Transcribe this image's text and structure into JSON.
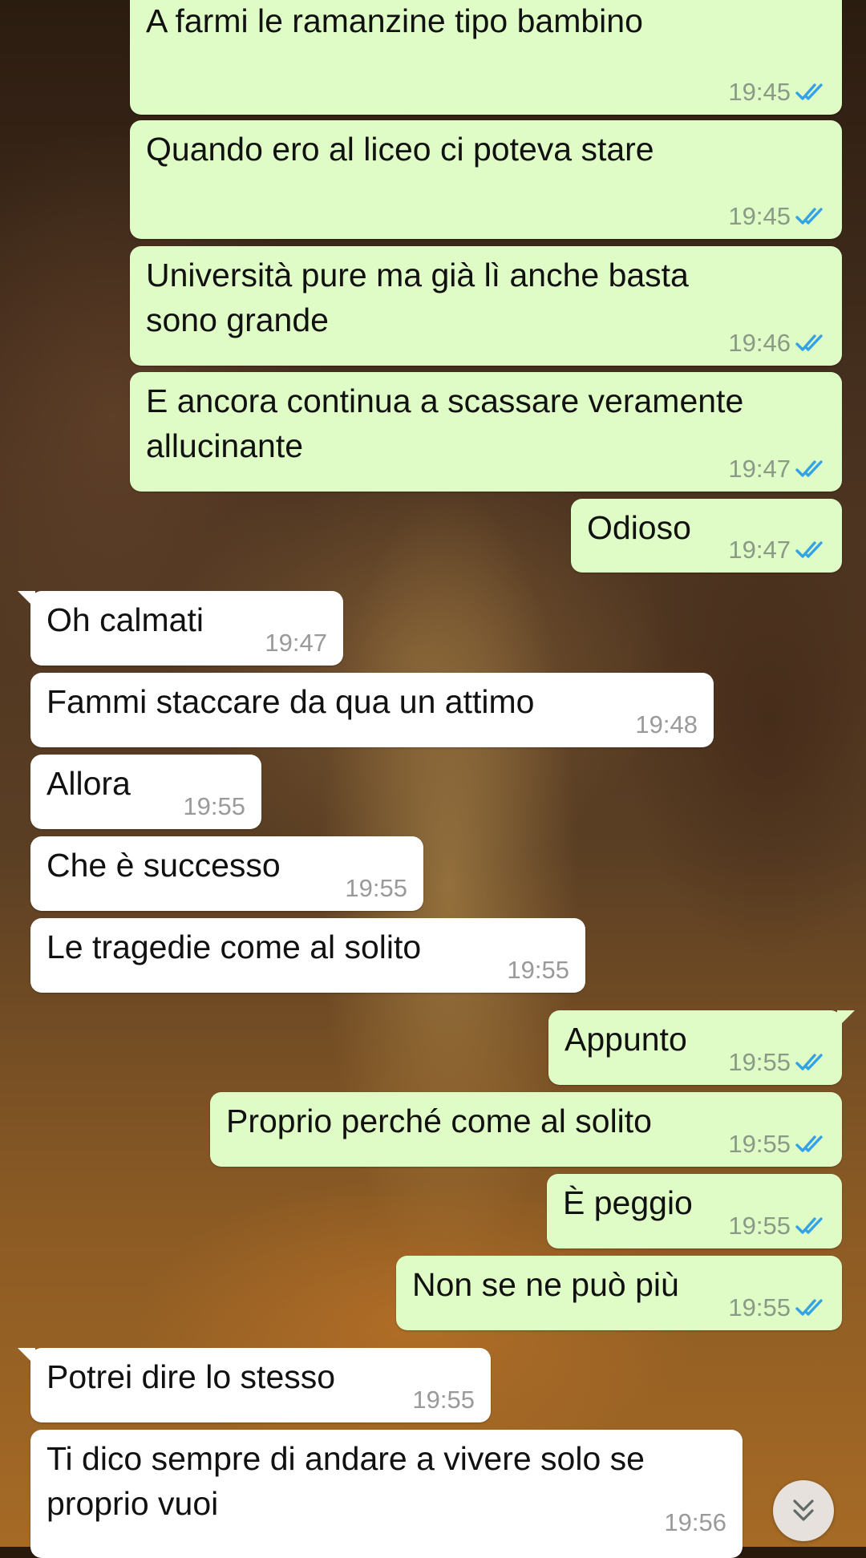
{
  "chat": {
    "messages": [
      {
        "dir": "out",
        "text": "A farmi le ramanzine tipo bambino",
        "time": "19:45",
        "read": true
      },
      {
        "dir": "out",
        "text": "Quando ero al liceo ci poteva stare",
        "time": "19:45",
        "read": true
      },
      {
        "dir": "out",
        "text": "Università pure ma già lì anche basta\nsono grande",
        "time": "19:46",
        "read": true
      },
      {
        "dir": "out",
        "text": "E ancora continua a scassare veramente\nallucinante",
        "time": "19:47",
        "read": true
      },
      {
        "dir": "out",
        "text": "Odioso",
        "time": "19:47",
        "read": true
      },
      {
        "dir": "in",
        "text": "Oh calmati",
        "time": "19:47"
      },
      {
        "dir": "in",
        "text": "Fammi staccare da qua un attimo",
        "time": "19:48"
      },
      {
        "dir": "in",
        "text": "Allora",
        "time": "19:55"
      },
      {
        "dir": "in",
        "text": "Che è successo",
        "time": "19:55"
      },
      {
        "dir": "in",
        "text": "Le tragedie come al solito",
        "time": "19:55"
      },
      {
        "dir": "out",
        "text": "Appunto",
        "time": "19:55",
        "read": true
      },
      {
        "dir": "out",
        "text": "Proprio perché come al solito",
        "time": "19:55",
        "read": true
      },
      {
        "dir": "out",
        "text": "È peggio",
        "time": "19:55",
        "read": true
      },
      {
        "dir": "out",
        "text": "Non se ne può più",
        "time": "19:55",
        "read": true
      },
      {
        "dir": "in",
        "text": "Potrei dire lo stesso",
        "time": "19:55"
      },
      {
        "dir": "in",
        "text": "Ti dico sempre di andare a vivere solo se\nproprio vuoi",
        "time": "19:56"
      }
    ]
  },
  "icons": {
    "read_receipt": "double-check-icon",
    "scroll_down": "chevron-double-down-icon"
  },
  "colors": {
    "outgoing_bubble": "#e0fcc6",
    "incoming_bubble": "#ffffff",
    "read_tick": "#34a3e6"
  }
}
